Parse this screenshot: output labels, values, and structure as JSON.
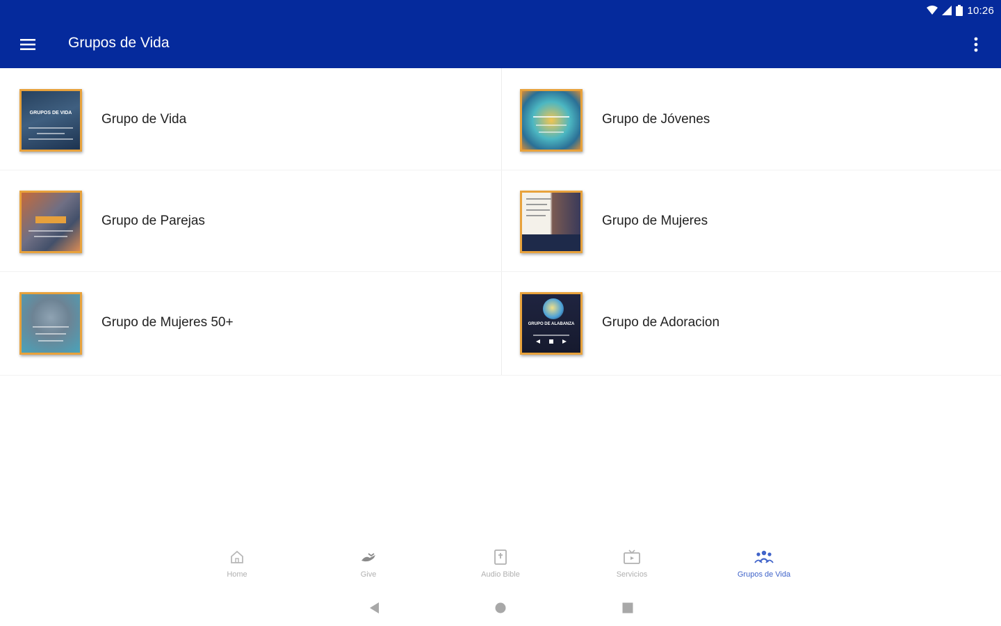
{
  "status_bar": {
    "time": "10:26",
    "icons": [
      "wifi-icon",
      "signal-icon",
      "battery-icon"
    ]
  },
  "app_bar": {
    "title": "Grupos de Vida",
    "menu_icon": "hamburger-menu-icon",
    "overflow_icon": "more-vert-icon",
    "color": "#052a9c"
  },
  "groups": [
    {
      "label": "Grupo de Vida",
      "thumb_text": "GRUPOS DE VIDA"
    },
    {
      "label": "Grupo de Jóvenes",
      "thumb_text": ""
    },
    {
      "label": "Grupo de Parejas",
      "thumb_text": ""
    },
    {
      "label": "Grupo de Mujeres",
      "thumb_text": ""
    },
    {
      "label": "Grupo de Mujeres 50+",
      "thumb_text": ""
    },
    {
      "label": "Grupo de Adoracion",
      "thumb_text": "GRUPO DE ALABANZA"
    }
  ],
  "bottom_nav": {
    "items": [
      {
        "label": "Home",
        "icon": "home-icon",
        "active": false
      },
      {
        "label": "Give",
        "icon": "give-hand-icon",
        "active": false
      },
      {
        "label": "Audio Bible",
        "icon": "bible-icon",
        "active": false
      },
      {
        "label": "Servicios",
        "icon": "tv-icon",
        "active": false
      },
      {
        "label": "Grupos de Vida",
        "icon": "group-icon",
        "active": true
      }
    ],
    "active_color": "#3f63c9",
    "inactive_color": "#b0b0b0"
  },
  "system_nav": {
    "back_icon": "back-triangle-icon",
    "home_icon": "home-circle-icon",
    "recents_icon": "recents-square-icon"
  }
}
